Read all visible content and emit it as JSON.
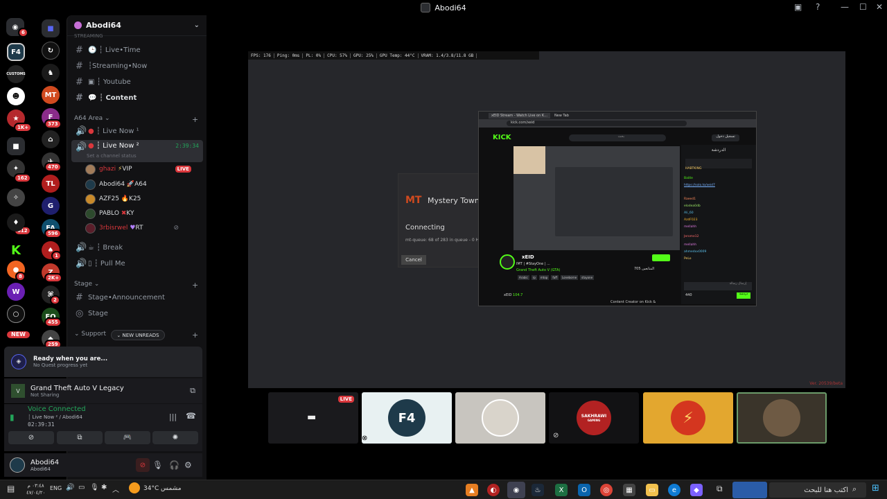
{
  "window": {
    "title": "Abodi64"
  },
  "server_badges": [
    "6",
    "1K+",
    "162",
    "612",
    "373",
    "470",
    "596",
    "2K+",
    "2",
    "455",
    "259",
    "8",
    "1",
    "NEW"
  ],
  "server_labels": {
    "customs": "CUSTOMS"
  },
  "guild": {
    "name": "Abodi64"
  },
  "channels": {
    "partial_category": "STREAMING",
    "livetime": "┆ Live•Time",
    "streaming_now": "┆Streaming•Now",
    "youtube": "┆ Youtube",
    "content": "┆ Content",
    "cat_a64": "A64 Area",
    "live_now_1": "┆ Live Now ¹",
    "live_now_2": "┆ Live Now ²",
    "live_now_2_time": "2:39:34",
    "channel_status_placeholder": "Set a channel status",
    "users": [
      {
        "name": "ghazi",
        "tag": "VIP",
        "live": "LIVE"
      },
      {
        "name": "Abodi64",
        "tag": "A64"
      },
      {
        "name": "AZF25",
        "tag": "K25"
      },
      {
        "name": "PABLO",
        "tag": "KY"
      },
      {
        "name": "3rbisrwel",
        "tag": "RT"
      }
    ],
    "break": "┆ Break",
    "pull_me": "┆ Pull Me",
    "cat_stage": "Stage",
    "stage_announcement": "Stage•Announcement",
    "stage": "Stage",
    "cat_support": "Support",
    "new_unreads": "NEW UNREADS"
  },
  "quest": {
    "title": "Ready when you are...",
    "subtitle": "No Quest progress yet"
  },
  "activity": {
    "game": "Grand Theft Auto V Legacy",
    "status": "Not Sharing"
  },
  "voice": {
    "status": "Voice Connected",
    "channel": "┆ Live Now ² / Abodi64",
    "timer": "02:39:31"
  },
  "user_panel": {
    "name": "Abodi64",
    "subtitle": "Abodi64"
  },
  "stream": {
    "stats": [
      "FPS: 176",
      "Ping: 0ms",
      "PL: 0%",
      "CPU: 57%",
      "GPU: 25%",
      "GPU Temp: 44°C",
      "VRAM: 1.4/3.8/11.8 GB"
    ],
    "dialog": {
      "brand": "Mystery Town",
      "status": "Connecting",
      "queue": "mt-queue: 68 of 283 in queue - 0 H",
      "cancel": "Cancel"
    },
    "browser": {
      "tab1": "xEID Stream - Watch Live on K...",
      "tab2": "New Tab",
      "url": "kick.com/xeid",
      "search_placeholder": "بحث",
      "login": "تسجيل دخول",
      "brand": "KICK",
      "streamer": "xEID",
      "stream_title": "IMT | #StayOne | ...",
      "category": "Grand Theft Auto V (GTA)",
      "followers": "705",
      "followers_label": "المتابعين",
      "tags": [
        "Arabic",
        "rp",
        "mtop",
        "faff",
        "Loneborne",
        "stayone"
      ],
      "about_name": "xEID",
      "about_followers": "104.7",
      "about_text": "Content Creator on Kick &",
      "chat_title": "الدردشة",
      "chat_lines": [
        "HABTKING",
        "Baitle",
        "https://solo.to/xeid7",
        "Raeed1",
        "elodea0db",
        "Ali_60",
        "AzdF023",
        "mellahh",
        "Jerome12",
        "mellahh",
        "ahmedxx0009",
        "PeLo"
      ],
      "chat_input": "إرسال رسالة",
      "chat_send": "دردشة",
      "chat_count": "440"
    },
    "version": "Ver. 20539/beta"
  },
  "tiles": {
    "live": "LIVE",
    "sakhrawi": "SAKHRAWI",
    "sakhrawi_sub": "GAMING"
  },
  "taskbar": {
    "search": "اكتب هنا للبحث",
    "weather_temp": "34°C",
    "weather_text": "مشمس",
    "lang": "ENG",
    "time": "٠٣:٤٨ م",
    "date": "٤٧/٠٤/٢٠"
  }
}
